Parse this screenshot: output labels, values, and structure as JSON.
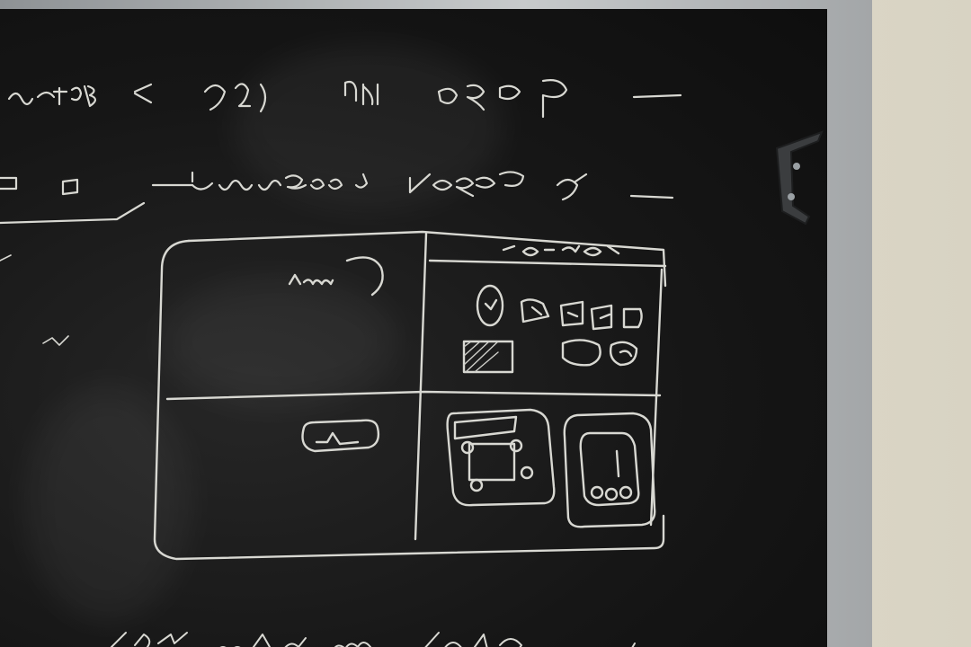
{
  "scene": {
    "subject": "chalkboard-sketch",
    "board_color": "#151515",
    "chalk_color": "#d8d8d2",
    "wall_color": "#dcd8c9",
    "frame_color": "#b6b9ba"
  }
}
